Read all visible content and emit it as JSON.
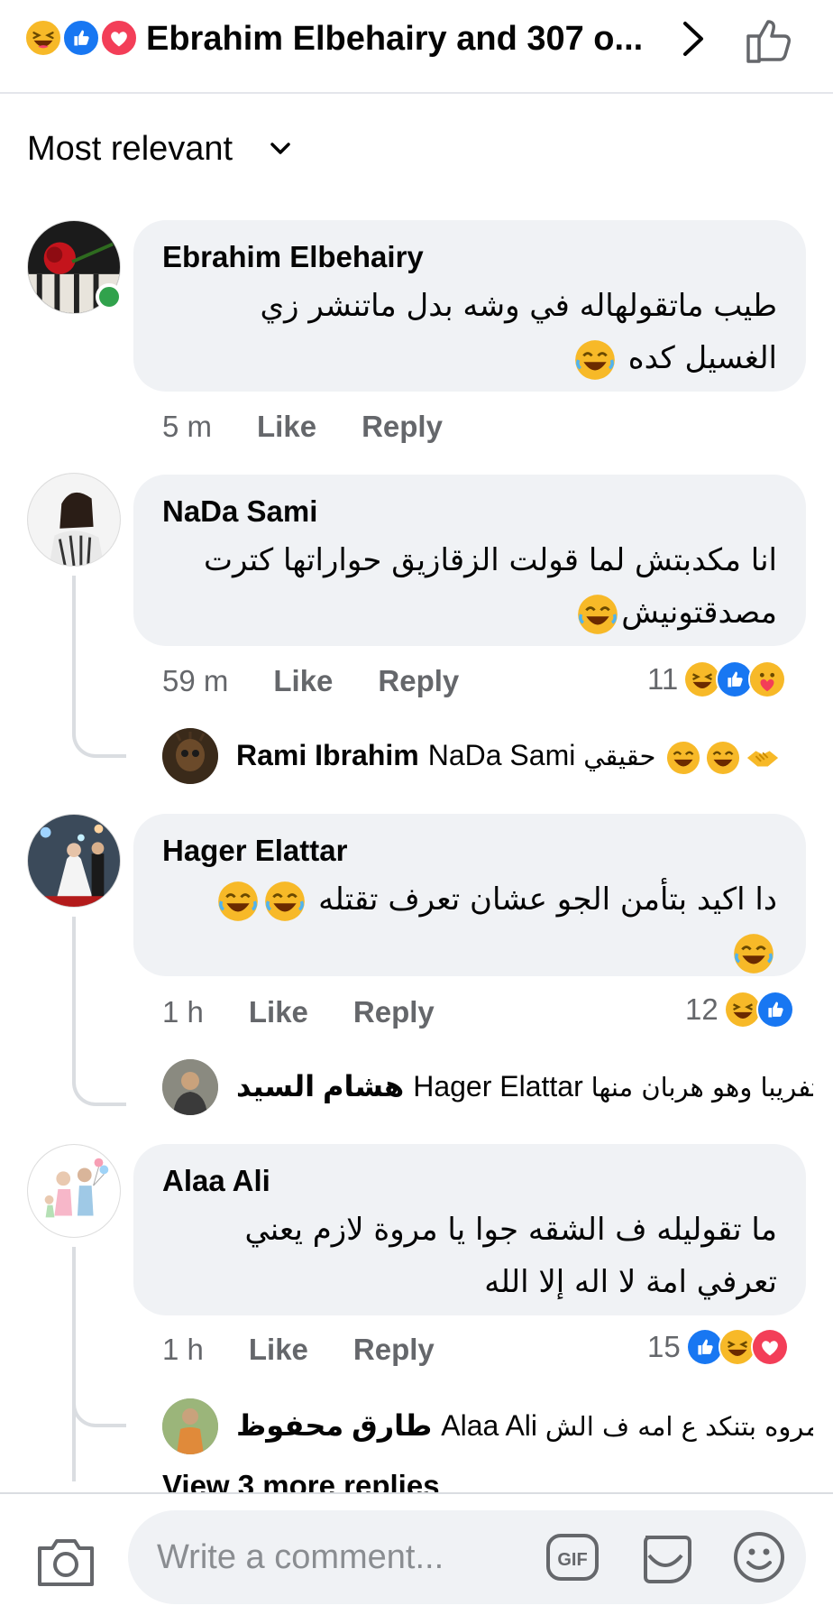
{
  "header": {
    "title": "Ebrahim Elbehairy and 307 o...",
    "reactions": [
      "haha-icon",
      "like-icon",
      "love-icon"
    ]
  },
  "sort": {
    "label": "Most relevant"
  },
  "comments": [
    {
      "author": "Ebrahim Elbehairy",
      "text_line1": "طيب ماتقولهاله في وشه بدل ماتنشر زي",
      "text_line2": "الغسيل كده",
      "time": "5 m",
      "like": "Like",
      "reply": "Reply"
    },
    {
      "author": "NaDa Sami",
      "text_line1": "انا مكدبتش لما قولت الزقازيق حواراتها كترت",
      "text_line2": "مصدقتونيش",
      "time": "59 m",
      "like": "Like",
      "reply": "Reply",
      "reaction_count": "11",
      "replies": [
        {
          "author": "Rami Ibrahim",
          "mention": "NaDa Sami",
          "text": "حقيقي"
        }
      ]
    },
    {
      "author": "Hager Elattar",
      "text_line1": "دا اكيد بتأمن الجو عشان تعرف تقتله",
      "time": "1 h",
      "like": "Like",
      "reply": "Reply",
      "reaction_count": "12",
      "replies": [
        {
          "author": "هشام السيد",
          "mention": "Hager Elattar",
          "text": "تفريبا وهو هربان منها"
        }
      ]
    },
    {
      "author": "Alaa Ali",
      "text_line1": "ما تقوليله ف الشقه جوا يا مروة لازم يعني",
      "text_line2": "تعرفي امة لا اله إلا الله",
      "time": "1 h",
      "like": "Like",
      "reply": "Reply",
      "reaction_count": "15",
      "replies": [
        {
          "author": "طارق محفوظ",
          "mention": "Alaa Ali",
          "text": "مروه بتنكد ع امه ف الش..."
        }
      ],
      "view_more": "View 3 more replies"
    }
  ],
  "composer": {
    "placeholder": "Write a comment..."
  },
  "colors": {
    "like_blue": "#1877f2",
    "haha_yellow": "#f7b928",
    "love_red": "#f33e58",
    "online_green": "#31a24c",
    "bubble_bg": "#f0f2f5",
    "meta_grey": "#65676b"
  }
}
